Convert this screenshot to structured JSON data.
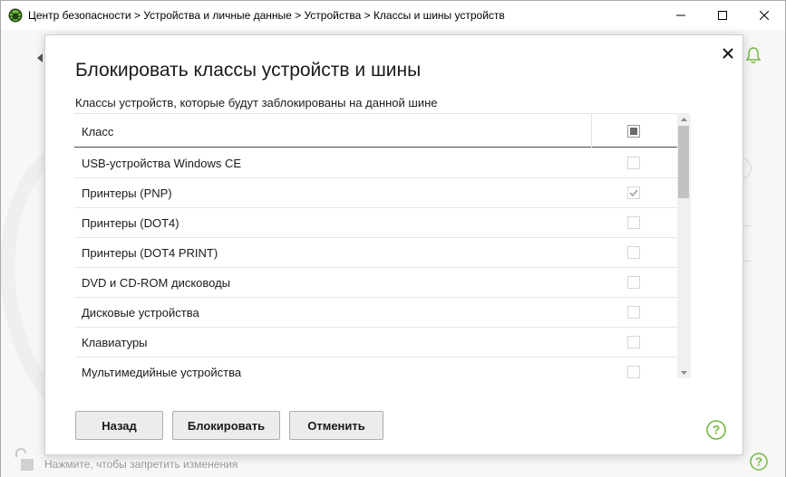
{
  "window": {
    "title": "Центр безопасности > Устройства и личные данные > Устройства > Классы и шины устройств",
    "icon": "dr-web-spider-icon",
    "accent_color": "#74b83e"
  },
  "background": {
    "lock_text": "Нажмите, чтобы запретить изменения"
  },
  "dialog": {
    "title": "Блокировать классы устройств и шины",
    "subtitle": "Классы устройств, которые будут заблокированы на данной шине",
    "header": {
      "class_label": "Класс",
      "select_all_state": "indeterminate"
    },
    "rows": [
      {
        "label": "USB-устройства Windows CE",
        "checked": false
      },
      {
        "label": "Принтеры (PNP)",
        "checked": true
      },
      {
        "label": "Принтеры (DOT4)",
        "checked": false
      },
      {
        "label": "Принтеры (DOT4 PRINT)",
        "checked": false
      },
      {
        "label": "DVD и CD-ROM дисководы",
        "checked": false
      },
      {
        "label": "Дисковые устройства",
        "checked": false
      },
      {
        "label": "Клавиатуры",
        "checked": false
      },
      {
        "label": "Мультимедийные устройства",
        "checked": false
      }
    ],
    "buttons": {
      "back": "Назад",
      "block": "Блокировать",
      "cancel": "Отменить"
    }
  }
}
